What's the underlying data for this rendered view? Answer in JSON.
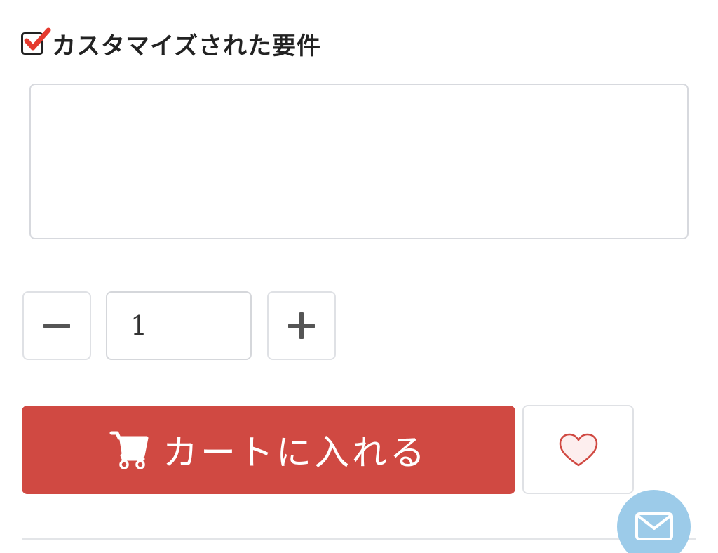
{
  "customization": {
    "checked": true,
    "title": "カスタマイズされた要件",
    "textarea_value": "",
    "textarea_placeholder": ""
  },
  "quantity": {
    "value": "1",
    "minus_icon": "minus-icon",
    "plus_icon": "plus-icon"
  },
  "cart": {
    "label": "カートに入れる",
    "icon": "cart-icon"
  },
  "wishlist": {
    "icon": "heart-icon"
  },
  "contact": {
    "icon": "mail-icon"
  },
  "colors": {
    "accent_red": "#d04942",
    "check_red": "#e53a2e",
    "mail_fab_blue": "#9ccbe9",
    "border_gray": "#dfe1e5",
    "heart_fill": "#fdeeee",
    "heart_stroke": "#d04942"
  }
}
